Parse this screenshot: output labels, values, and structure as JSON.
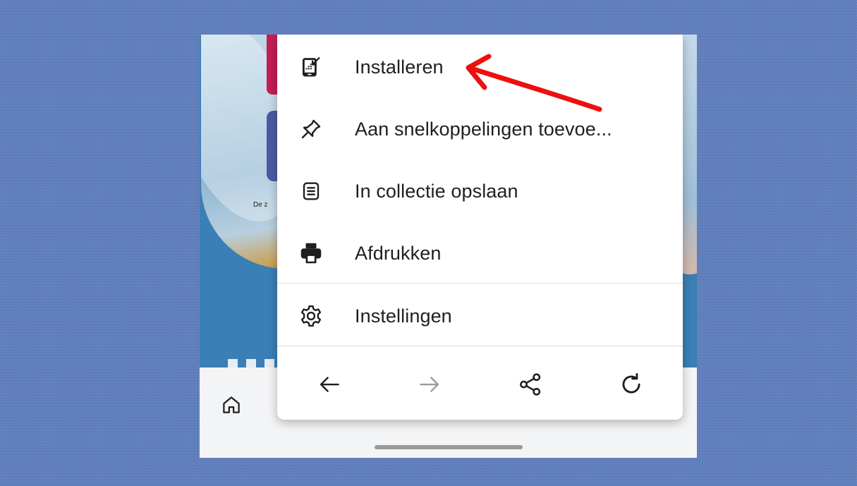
{
  "menu": {
    "items": [
      {
        "label": "Installeren",
        "icon": "install-app-icon"
      },
      {
        "label": "Aan snelkoppelingen toevoe...",
        "icon": "pin-icon"
      },
      {
        "label": "In collectie opslaan",
        "icon": "collection-icon"
      },
      {
        "label": "Afdrukken",
        "icon": "printer-icon"
      },
      {
        "label": "Instellingen",
        "icon": "gear-icon"
      }
    ],
    "nav": [
      {
        "icon": "arrow-left-icon",
        "enabled": true
      },
      {
        "icon": "arrow-right-icon",
        "enabled": false
      },
      {
        "icon": "share-icon",
        "enabled": true
      },
      {
        "icon": "refresh-icon",
        "enabled": true
      }
    ]
  },
  "page": {
    "caption_snippet": "De z"
  },
  "bottom_bar": {
    "home_icon": "home-icon"
  },
  "annotation": {
    "icon": "red-arrow-annotation",
    "color": "#ee0f0f"
  },
  "colors": {
    "background": "#5f7dba",
    "page_blue": "#3a7fb6",
    "tile_red": "#c31e56",
    "tile_purple": "#4d5aa3",
    "menu_bg": "#ffffff",
    "text": "#1f1f1f"
  }
}
